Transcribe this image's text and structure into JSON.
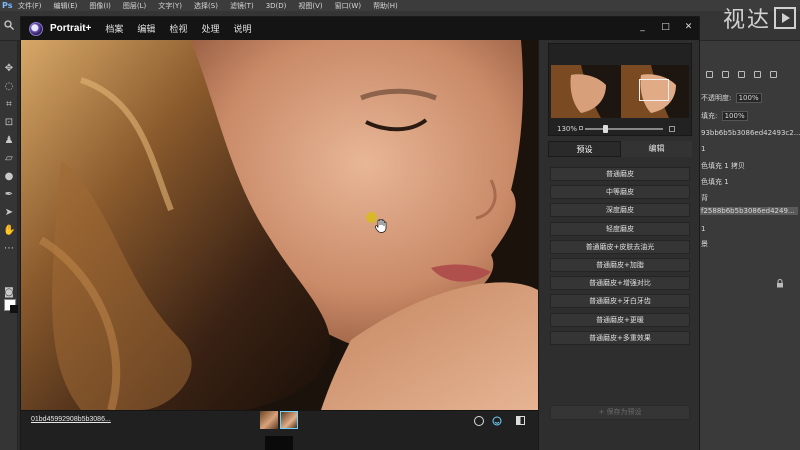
{
  "ps": {
    "logo": "Ps",
    "menu": [
      "文件(F)",
      "编辑(E)",
      "图像(I)",
      "图层(L)",
      "文字(Y)",
      "选择(S)",
      "滤镜(T)",
      "3D(D)",
      "视图(V)",
      "窗口(W)",
      "帮助(H)"
    ],
    "watermark": "视达",
    "panel": {
      "opacity_label": "不透明度:",
      "opacity_value": "100%",
      "fill_label": "填充:",
      "fill_value": "100%",
      "layer_rows": [
        "93bb6b5b3086ed42493c2...",
        "1",
        "色填充 1 拷贝",
        "色填充 1",
        "背",
        "f2588b6b5b3086ed4249...",
        "1",
        "景"
      ]
    }
  },
  "plugin": {
    "name": "Portrait+",
    "menu": [
      "档案",
      "编辑",
      "检视",
      "处理",
      "说明"
    ],
    "controls": [
      "_",
      "□",
      "✕"
    ],
    "zoom_label": "130%",
    "tabs": {
      "presets": "预设",
      "edit": "编辑"
    },
    "presets": [
      "普通磨皮",
      "中等磨皮",
      "深度磨皮",
      "轻度磨皮",
      "普通磨皮+皮肤去油光",
      "普通磨皮+加脂",
      "普通磨皮+增强对比",
      "普通磨皮+牙白牙齿",
      "普通磨皮+更暖",
      "普通磨皮+多重效果"
    ],
    "save_preset": "+ 保存为预设",
    "filename": "01bd45992908b5b3086..."
  },
  "colors": {
    "accent_border": "#6fd2ff",
    "cursor_dot": "#d8b82a"
  }
}
